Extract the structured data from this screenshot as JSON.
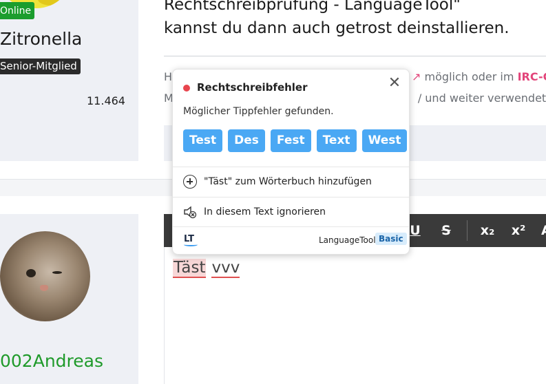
{
  "profile_top": {
    "status_badge": "Online",
    "username": "Zitronella",
    "role": "Senior-Mitglied",
    "post_count": "11.464"
  },
  "post": {
    "line1": "Rechtschreibprüfung - LanguageTool\"",
    "line2": "kannst du dann auch getrost deinstallieren."
  },
  "info": {
    "line1_prefix": "H",
    "line1_suffix": "möglich oder im",
    "irc_link": "IRC-C",
    "line2_prefix": "M",
    "line2_suffix": "/ und weiter verwendet/ko"
  },
  "profile_bottom": {
    "username": "002Andreas"
  },
  "editor": {
    "toolbar": {
      "underline": "U",
      "strikethrough": "S",
      "subscript": "x₂",
      "superscript": "x²",
      "more": "A"
    },
    "words": [
      "Täst",
      "vvv"
    ]
  },
  "languagetool_popup": {
    "title": "Rechtschreibfehler",
    "message": "Möglicher Tippfehler gefunden.",
    "suggestions": [
      "Test",
      "Des",
      "Fest",
      "Text",
      "West"
    ],
    "add_to_dictionary": "\"Täst\" zum Wörterbuch hinzufügen",
    "ignore": "In diesem Text ignorieren",
    "logo_text": "LT",
    "brand": "LanguageTool",
    "plan": "Basic",
    "colors": {
      "error_dot": "#e8454e",
      "suggestion_bg": "#4aa8f4"
    }
  }
}
